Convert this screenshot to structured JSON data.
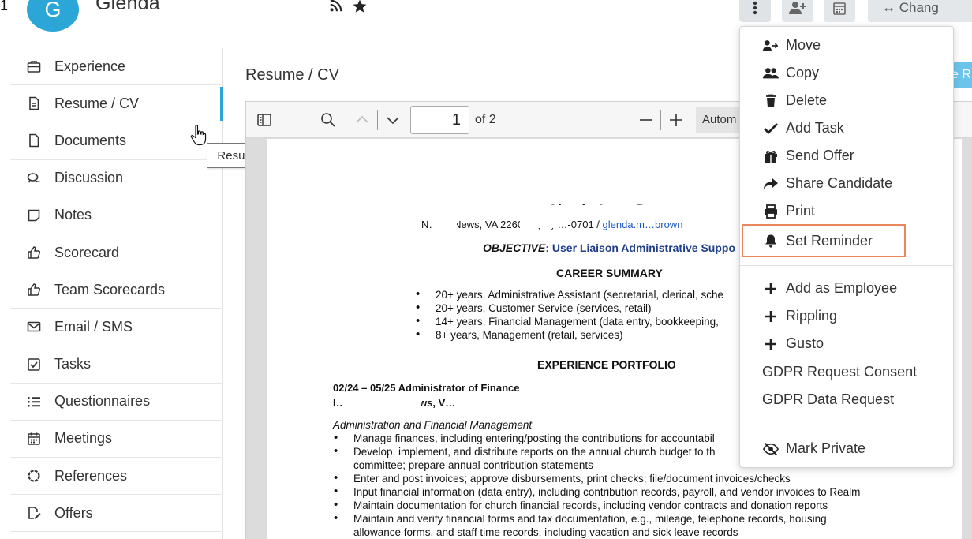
{
  "header": {
    "edge_glyph": "1",
    "avatar_letter": "G",
    "candidate_name": "Glenda",
    "change_label": "↔ Chang"
  },
  "sidebar": {
    "items": [
      {
        "label": "Experience",
        "icon": "briefcase-icon"
      },
      {
        "label": "Resume / CV",
        "icon": "file-text-icon"
      },
      {
        "label": "Documents",
        "icon": "file-icon"
      },
      {
        "label": "Discussion",
        "icon": "chat-icon"
      },
      {
        "label": "Notes",
        "icon": "note-icon"
      },
      {
        "label": "Scorecard",
        "icon": "thumbs-up-icon"
      },
      {
        "label": "Team Scorecards",
        "icon": "thumbs-up-icon"
      },
      {
        "label": "Email / SMS",
        "icon": "envelope-icon"
      },
      {
        "label": "Tasks",
        "icon": "checkbox-icon"
      },
      {
        "label": "Questionnaires",
        "icon": "list-icon"
      },
      {
        "label": "Meetings",
        "icon": "calendar-icon"
      },
      {
        "label": "References",
        "icon": "circle-icon"
      },
      {
        "label": "Offers",
        "icon": "signature-icon"
      }
    ],
    "tooltip": "Resume / CV"
  },
  "main": {
    "page_title": "Resume / CV",
    "hidden_button_label": "e R"
  },
  "viewer": {
    "current_page": "1",
    "page_of": "of 2",
    "zoom_value": "Autom"
  },
  "document": {
    "name": "Glenda A…er Brown",
    "contact_prefix": "N…ort News, VA 22601 / (…) …-0701 /",
    "contact_link": "glenda.m…brown",
    "objective_label": "OBJECTIVE",
    "objective_text": ": User Liaison Administrative Suppo",
    "career_heading": "CAREER SUMMARY",
    "career_bullets": [
      "20+ years, Administrative Assistant (secretarial, clerical, sche",
      "20+ years, Customer Service (services, retail)",
      "14+ years, Financial Management (data entry, bookkeeping,",
      "8+ years, Management (retail, services)"
    ],
    "experience_heading": "EXPERIENCE PORTFOLIO",
    "role_line": "02/24 – 05/25 Administrator of Finance",
    "org_line": "I… … Newport News, V…",
    "admin_heading": "Administration and Financial Management",
    "duty_bullets": [
      "Manage finances, including entering/posting the contributions for accountabil",
      "Develop, implement, and distribute reports on the annual church budget to th",
      "committee; prepare annual contribution statements",
      "Enter and post invoices; approve disbursements, print checks; file/document invoices/checks",
      "Input financial information (data entry), including contribution records, payroll, and vendor invoices to Realm",
      "Maintain documentation for church financial records, including vendor contracts and donation reports",
      "Maintain and verify financial forms and tax documentation, e.g., mileage, telephone records, housing",
      "allowance forms, and staff time records, including vacation and sick leave records"
    ]
  },
  "menu": {
    "items": [
      {
        "label": "Move",
        "icon": "user-arrow-icon"
      },
      {
        "label": "Copy",
        "icon": "users-icon"
      },
      {
        "label": "Delete",
        "icon": "trash-icon"
      },
      {
        "label": "Add Task",
        "icon": "check-icon"
      },
      {
        "label": "Send Offer",
        "icon": "gift-icon"
      },
      {
        "label": "Share Candidate",
        "icon": "share-icon"
      },
      {
        "label": "Print",
        "icon": "print-icon"
      },
      {
        "label": "Set Reminder",
        "icon": "bell-icon"
      },
      {
        "label": "Add as Employee",
        "icon": "plus-icon"
      },
      {
        "label": "Rippling",
        "icon": "plus-icon"
      },
      {
        "label": "Gusto",
        "icon": "plus-icon"
      },
      {
        "label": "GDPR Request Consent",
        "icon": ""
      },
      {
        "label": "GDPR Data Request",
        "icon": ""
      },
      {
        "label": "Mark Private",
        "icon": "eye-slash-icon"
      }
    ],
    "highlight_color": "#e8875b"
  },
  "colors": {
    "accent": "#2ba6d6",
    "link": "#1a56c4",
    "objective": "#1f3d8a"
  }
}
